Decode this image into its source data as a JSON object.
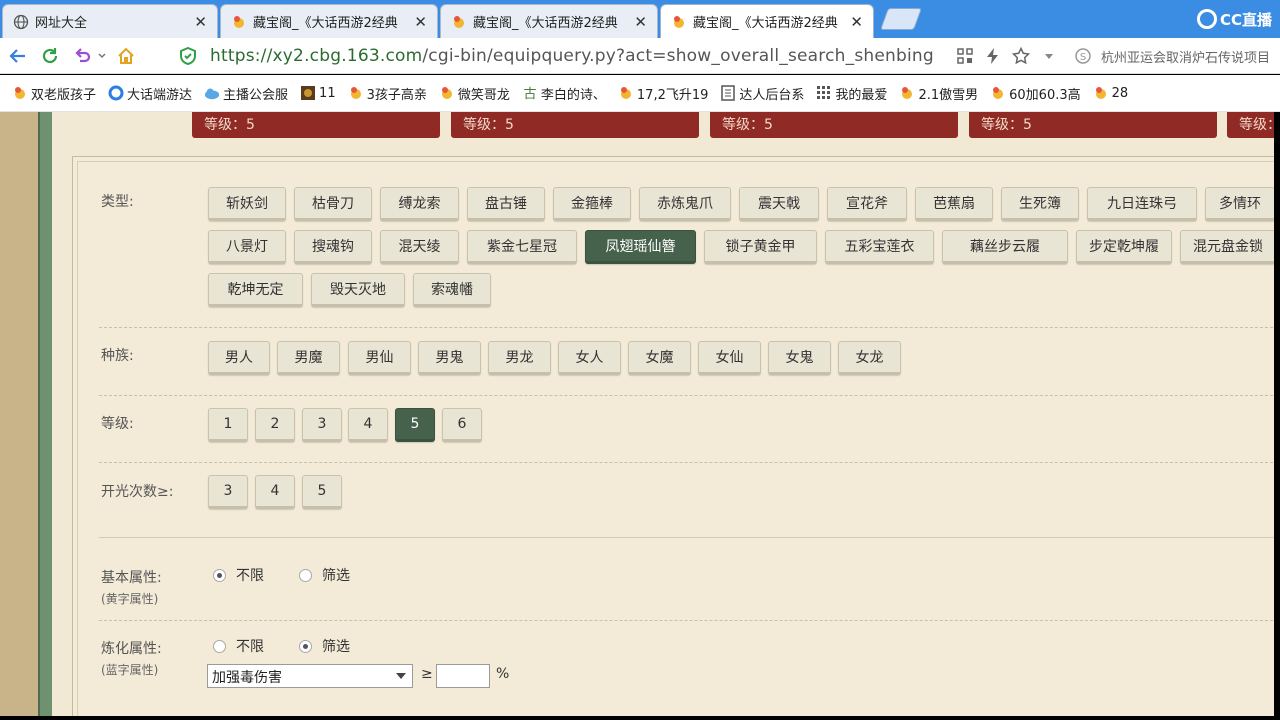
{
  "tabs": [
    {
      "title": "网址大全",
      "icon": "globe-icon"
    },
    {
      "title": "藏宝阁_《大话西游2经典",
      "icon": "treasure-icon"
    },
    {
      "title": "藏宝阁_《大话西游2经典",
      "icon": "treasure-icon"
    },
    {
      "title": "藏宝阁_《大话西游2经典",
      "icon": "treasure-icon",
      "active": true
    }
  ],
  "brand": "CC直播",
  "address": {
    "secure_part": "https://xy2.cbg.163.com",
    "path_part": "/cgi-bin/equipquery.py?act=show_overall_search_shenbing",
    "search_hint": "杭州亚运会取消炉石传说项目"
  },
  "bookmarks": [
    {
      "label": "双老版孩子",
      "icon": "treasure-icon"
    },
    {
      "label": "大话端游达",
      "icon": "cc-icon"
    },
    {
      "label": "主播公会服",
      "icon": "cloud-icon"
    },
    {
      "label": "11",
      "icon": "game-icon"
    },
    {
      "label": "3孩子高亲",
      "icon": "treasure-icon"
    },
    {
      "label": "微笑哥龙",
      "icon": "treasure-icon"
    },
    {
      "label": "李白的诗、",
      "icon": "ancient-icon"
    },
    {
      "label": "17,2飞升19",
      "icon": "treasure-icon"
    },
    {
      "label": "达人后台系",
      "icon": "document-icon"
    },
    {
      "label": "我的最爱",
      "icon": "grid-icon"
    },
    {
      "label": "2.1傲雪男",
      "icon": "treasure-icon"
    },
    {
      "label": "60加60.3高",
      "icon": "treasure-icon"
    },
    {
      "label": "28",
      "icon": "treasure-icon"
    }
  ],
  "grade_boxes": [
    "等级：5",
    "等级：5",
    "等级：5",
    "等级：5",
    "等级：5"
  ],
  "filters": {
    "type": {
      "label": "类型:",
      "row1": [
        "斩妖剑",
        "枯骨刀",
        "缚龙索",
        "盘古锤",
        "金箍棒",
        "赤炼鬼爪",
        "震天戟",
        "宣花斧",
        "芭蕉扇",
        "生死簿",
        "九日连珠弓",
        "多情环"
      ],
      "row2": [
        "八景灯",
        "搜魂钩",
        "混天绫",
        "紫金七星冠",
        "凤翅瑶仙簪",
        "锁子黄金甲",
        "五彩宝莲衣",
        "藕丝步云履",
        "步定乾坤履",
        "混元盘金锁"
      ],
      "row3": [
        "乾坤无定",
        "毁天灭地",
        "索魂幡"
      ],
      "selected": "凤翅瑶仙簪"
    },
    "race": {
      "label": "种族:",
      "options": [
        "男人",
        "男魔",
        "男仙",
        "男鬼",
        "男龙",
        "女人",
        "女魔",
        "女仙",
        "女鬼",
        "女龙"
      ]
    },
    "level": {
      "label": "等级:",
      "options": [
        "1",
        "2",
        "3",
        "4",
        "5",
        "6"
      ],
      "selected": "5"
    },
    "open_count": {
      "label": "开光次数≥:",
      "options": [
        "3",
        "4",
        "5"
      ]
    },
    "base_attr": {
      "label": "基本属性:",
      "sub": "(黄字属性)",
      "opt_all": "不限",
      "opt_filter": "筛选",
      "selected": "不限"
    },
    "refine_attr": {
      "label": "炼化属性:",
      "sub": "(蓝字属性)",
      "opt_all": "不限",
      "opt_filter": "筛选",
      "selected": "筛选",
      "select_value": "加强毒伤害",
      "ge": "≥",
      "input_value": "",
      "unit": "%"
    }
  },
  "colors": {
    "tab_strip": "#3b8de4",
    "grade_box": "#8f2a25",
    "selected_option": "#46614c",
    "page_bg": "#f2e9d5"
  }
}
